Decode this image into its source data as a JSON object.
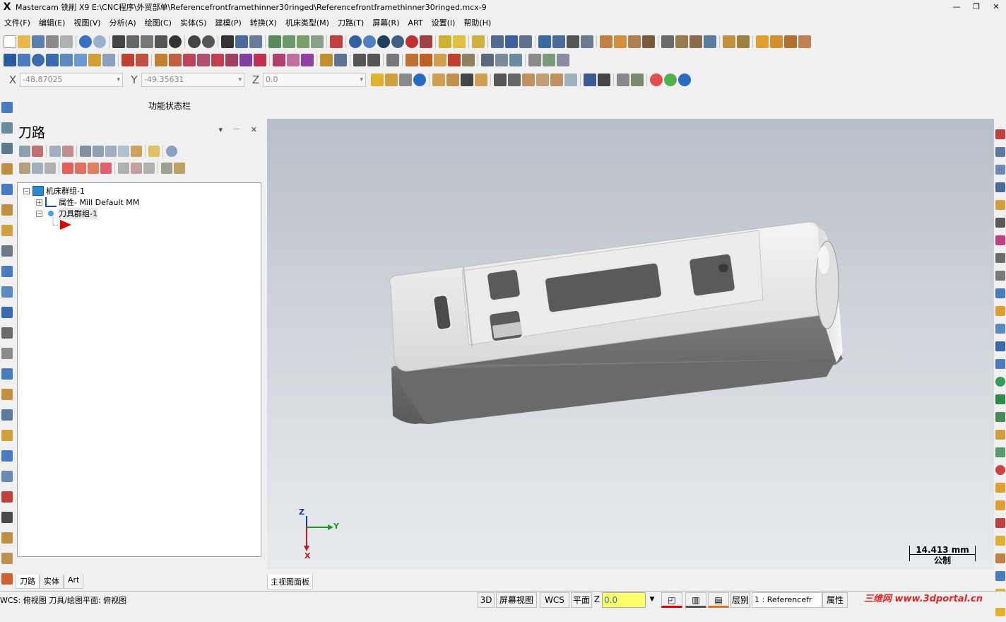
{
  "window": {
    "title": "Mastercam 铣削 X9  E:\\CNC程序\\外贸部单\\Referencefrontframethinner30ringed\\Referencefrontframethinner30ringed.mcx-9",
    "logo": "X",
    "minimize": "—",
    "restore": "❐",
    "close": "✕"
  },
  "menu": [
    "文件(F)",
    "编辑(E)",
    "视图(V)",
    "分析(A)",
    "绘图(C)",
    "实体(S)",
    "建模(P)",
    "转换(X)",
    "机床类型(M)",
    "刀路(T)",
    "屏幕(R)",
    "ART",
    "设置(I)",
    "帮助(H)"
  ],
  "coords": {
    "x_label": "X",
    "x_value": "-48.87025",
    "y_label": "Y",
    "y_value": "-49.35631",
    "z_label": "Z",
    "z_value": "0.0"
  },
  "function_bar": "功能状态栏",
  "panel": {
    "title": "刀路",
    "controls": "▾ 𝄖 ✕",
    "tree": {
      "root": "机床群组-1",
      "props_label": "属性",
      "props_value": " - Mill Default MM",
      "toolgroup": "刀具群组-1"
    },
    "tabs": [
      "刀路",
      "实体",
      "Art"
    ]
  },
  "viewport": {
    "tab": "主视图面板",
    "axis_z": "Z",
    "axis_y": "Y",
    "axis_x": "X",
    "scale_value": "14.413 mm",
    "scale_unit": "公制"
  },
  "status": {
    "wcs_text": "WCS: 俯视图  刀具/绘图平面: 俯视图",
    "mode_3d": "3D",
    "screen_view": "屏幕视图",
    "wcs": "WCS",
    "plane": "平面",
    "z_label": "Z",
    "z_value": "0.0",
    "layer": "层别",
    "layer_value": "1 : Referencefr",
    "attributes": "属性",
    "watermark": "三维网 www.3dportal.cn"
  },
  "colors": {
    "accent_blue": "#1c5fb3",
    "z_field_yellow": "#ffff66",
    "watermark_red": "#e0262a",
    "tool_arrow_red": "#e00000"
  }
}
